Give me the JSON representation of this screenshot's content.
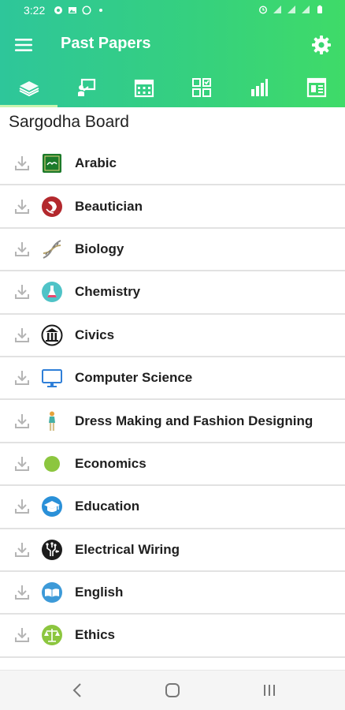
{
  "status": {
    "time": "3:22"
  },
  "appbar": {
    "title": "Past Papers"
  },
  "tabs": [
    {
      "icon": "books-icon",
      "active": true
    },
    {
      "icon": "presenter-icon",
      "active": false
    },
    {
      "icon": "calendar-icon",
      "active": false
    },
    {
      "icon": "grid-icon",
      "active": false
    },
    {
      "icon": "bar-chart-icon",
      "active": false
    },
    {
      "icon": "newspaper-icon",
      "active": false
    }
  ],
  "board": {
    "title": "Sargodha Board"
  },
  "subjects": [
    {
      "label": "Arabic",
      "icon": "arabic-icon"
    },
    {
      "label": "Beautician",
      "icon": "beautician-icon"
    },
    {
      "label": "Biology",
      "icon": "dna-icon"
    },
    {
      "label": "Chemistry",
      "icon": "flask-icon"
    },
    {
      "label": "Civics",
      "icon": "pillars-icon"
    },
    {
      "label": "Computer Science",
      "icon": "monitor-icon"
    },
    {
      "label": "Dress Making and Fashion Designing",
      "icon": "mannequin-icon"
    },
    {
      "label": "Economics",
      "icon": "economics-icon"
    },
    {
      "label": "Education",
      "icon": "graduation-cap-icon"
    },
    {
      "label": "Electrical Wiring",
      "icon": "circuit-icon"
    },
    {
      "label": "English",
      "icon": "book-icon"
    },
    {
      "label": "Ethics",
      "icon": "scales-icon"
    }
  ],
  "colors": {
    "header_start": "#2ec69a",
    "header_end": "#3fdb68",
    "text": "#1f1f1f",
    "divider": "#e2e2e2",
    "download": "#b5b5b5"
  }
}
